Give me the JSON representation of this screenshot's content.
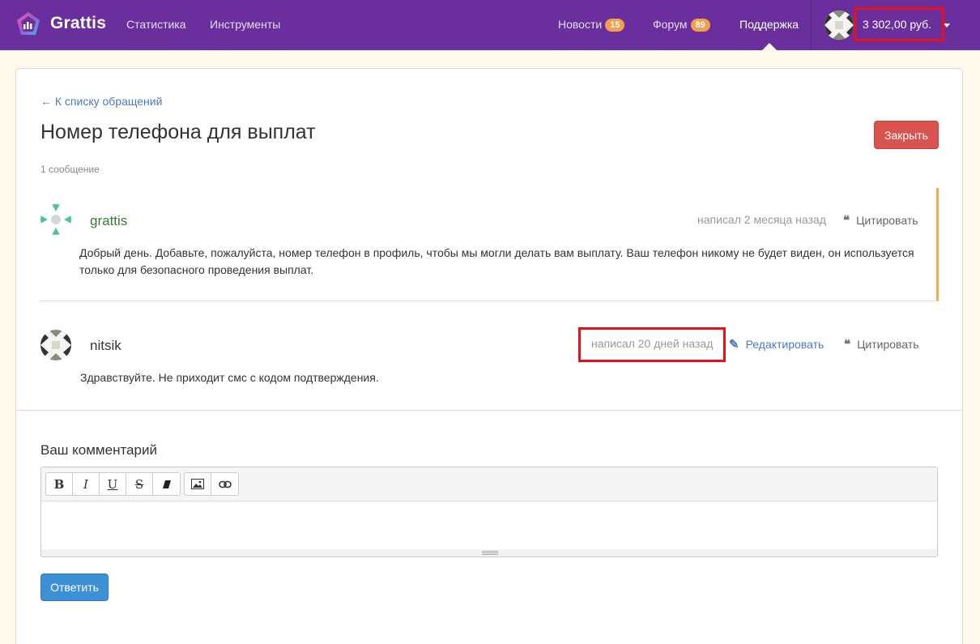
{
  "app": {
    "brand": "Grattis",
    "nav": {
      "stats": "Статистика",
      "tools": "Инструменты",
      "news": "Новости",
      "news_count": "15",
      "forum": "Форум",
      "forum_count": "89",
      "support": "Поддержка"
    },
    "balance": "3 302,00 руб."
  },
  "ticket": {
    "back_link": "← К списку обращений",
    "title": "Номер телефона для выплат",
    "close_label": "Закрыть",
    "message_count": "1 сообщение"
  },
  "messages": [
    {
      "author": "grattis",
      "meta": "написал 2 месяца назад",
      "quote_label": "Цитировать",
      "text": "Добрый день. Добавьте, пожалуйста, номер телефон в профиль, чтобы мы могли делать вам выплату. Ваш телефон никому не будет виден, он используется только для безопасного проведения выплат."
    },
    {
      "author": "nitsik",
      "meta": "написал 20 дней назад",
      "edit_label": "Редактировать",
      "quote_label": "Цитировать",
      "text": "Здравствуйте. Не приходит смс с кодом подтверждения."
    }
  ],
  "comment": {
    "label": "Ваш комментарий",
    "toolbar": {
      "bold": "B",
      "italic": "I",
      "underline": "U",
      "strike": "S"
    },
    "reply_label": "Ответить"
  },
  "colors": {
    "header": "#6a2f9c",
    "badge": "#f2a04b",
    "accent_border": "#f0ad4e",
    "close_button": "#d9534f",
    "reply_button": "#3d8fd6",
    "highlight": "#e8101b",
    "admin_name": "#3c7a3c"
  },
  "icons": {
    "logo": "grattis-logo-icon",
    "quote": "quote-icon",
    "edit": "pencil-icon",
    "caret": "caret-down-icon",
    "image": "image-icon",
    "link": "link-icon",
    "eraser": "eraser-icon"
  }
}
